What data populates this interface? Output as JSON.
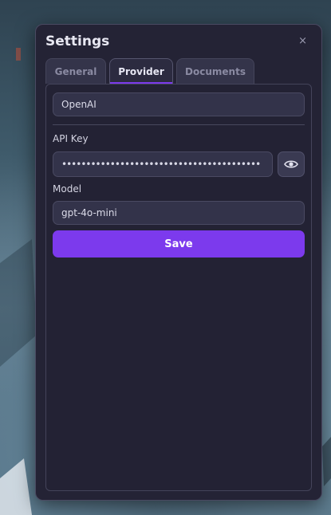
{
  "settings": {
    "title": "Settings",
    "close_label": "×",
    "tabs": [
      "General",
      "Provider",
      "Documents"
    ],
    "active_tab": "Provider",
    "provider": {
      "selected": "OpenAI",
      "api_key_label": "API Key",
      "api_key_masked": "••••••••••••••••••••••••••••••••••••••••••••••••••••••••",
      "model_label": "Model",
      "model_value": "gpt-4o-mini",
      "save_label": "Save"
    }
  },
  "icons": {
    "reveal": "eye-icon",
    "close": "close-icon"
  },
  "colors": {
    "accent": "#7c3aed",
    "window_bg": "#242335",
    "field_bg": "#33334a"
  }
}
